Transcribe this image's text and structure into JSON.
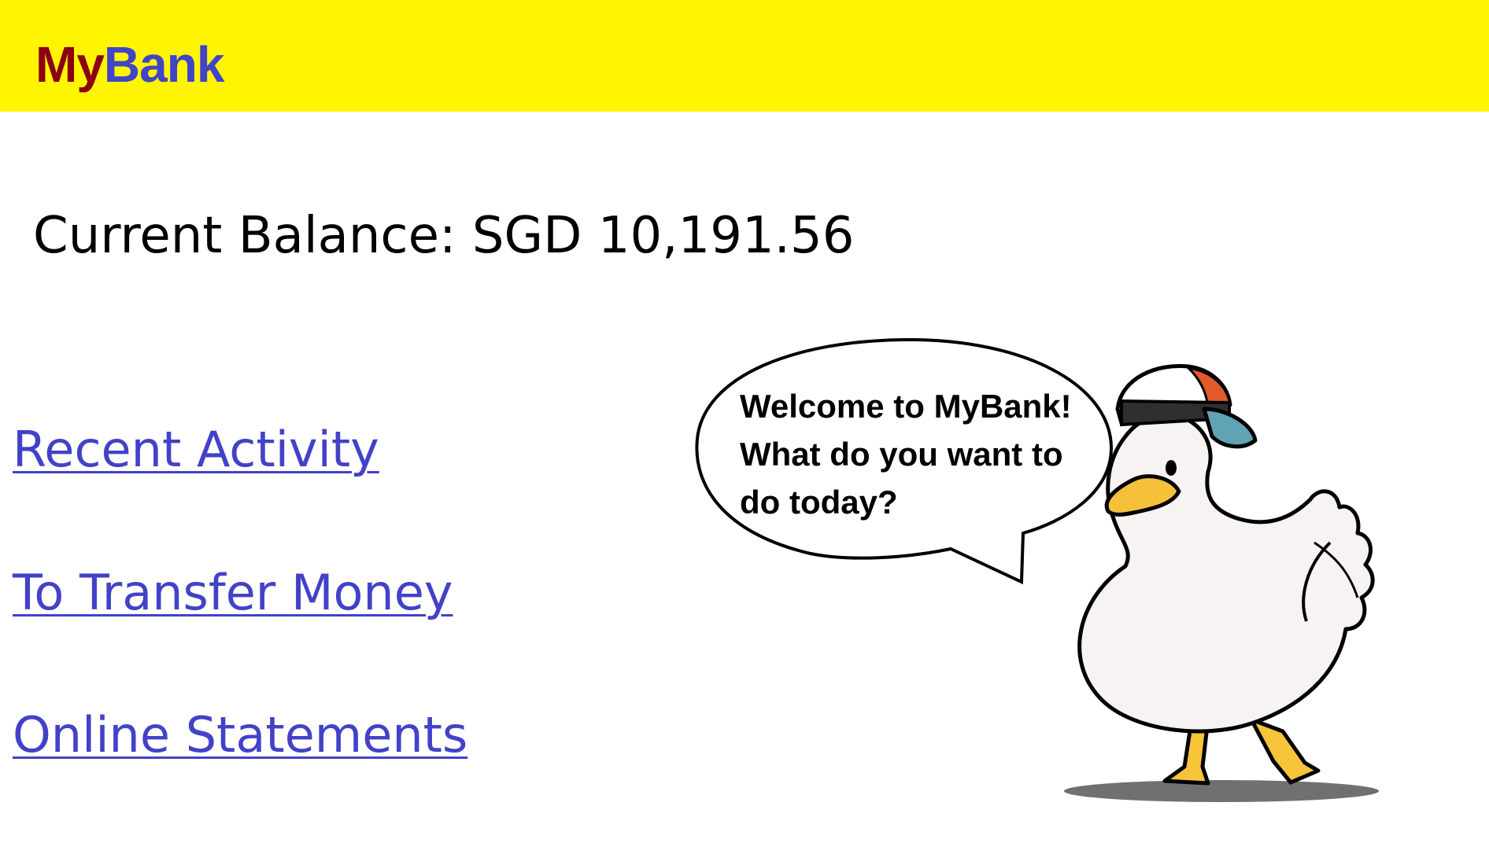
{
  "header": {
    "logo_part1": "My",
    "logo_part2": "Bank",
    "background_color": "#fff500",
    "logo_color_my": "#8b0012",
    "logo_color_bank": "#3f44c8"
  },
  "balance": {
    "text": "Current Balance: SGD 10,191.56"
  },
  "nav": {
    "link_color": "#4242c8",
    "items": [
      {
        "label": "Recent Activity"
      },
      {
        "label": "To Transfer Money"
      },
      {
        "label": "Online Statements"
      }
    ]
  },
  "mascot": {
    "speech_lines": [
      "Welcome to MyBank!",
      "What do you want to",
      "do today?"
    ],
    "icon": "duck-mascot-icon"
  }
}
